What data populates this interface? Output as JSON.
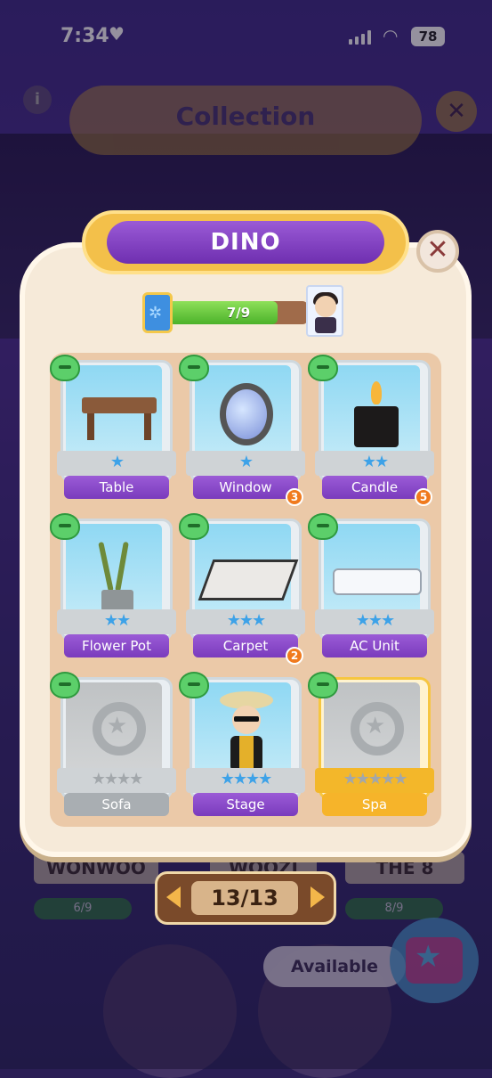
{
  "status_bar": {
    "time": "7:34",
    "battery": "78"
  },
  "background": {
    "screen_title": "Collection",
    "members": [
      {
        "name": "WONWOO",
        "progress": "6/9"
      },
      {
        "name": "WOOZI",
        "progress": ""
      },
      {
        "name": "THE 8",
        "progress": "8/9"
      }
    ],
    "available_label": "Available"
  },
  "modal": {
    "title": "DINO",
    "progress_text": "7/9",
    "progress_fraction": 0.78,
    "cards": [
      {
        "name": "Table",
        "stars": "★",
        "badge": "",
        "state": "owned"
      },
      {
        "name": "Window",
        "stars": "★",
        "badge": "3",
        "state": "owned"
      },
      {
        "name": "Candle",
        "stars": "★★",
        "badge": "5",
        "state": "owned"
      },
      {
        "name": "Flower Pot",
        "stars": "★★",
        "badge": "",
        "state": "owned"
      },
      {
        "name": "Carpet",
        "stars": "★★★",
        "badge": "2",
        "state": "owned"
      },
      {
        "name": "AC Unit",
        "stars": "★★★",
        "badge": "",
        "state": "owned"
      },
      {
        "name": "Sofa",
        "stars": "★★★★",
        "badge": "",
        "state": "locked"
      },
      {
        "name": "Stage",
        "stars": "★★★★",
        "badge": "",
        "state": "owned"
      },
      {
        "name": "Spa",
        "stars": "★★★★★",
        "badge": "",
        "state": "locked-gold"
      }
    ]
  },
  "pager": {
    "label": "13/13"
  },
  "colors": {
    "accent_purple": "#7a3bbd",
    "gold": "#f3c04a",
    "progress_green": "#4bb22a"
  }
}
